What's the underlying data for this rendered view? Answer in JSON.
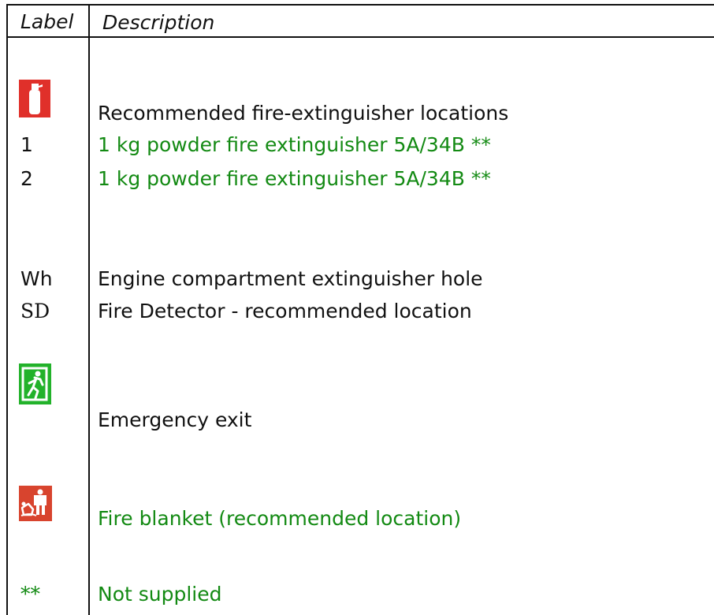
{
  "header": {
    "label": "Label",
    "description": "Description"
  },
  "icons": {
    "extinguisher": "fire-extinguisher-icon",
    "exit": "emergency-exit-icon",
    "blanket": "fire-blanket-icon"
  },
  "rows": {
    "extinguisher_locations": "Recommended fire-extinguisher locations",
    "ext1_label": "1",
    "ext1_desc": "1 kg powder fire extinguisher 5A/34B **",
    "ext2_label": "2",
    "ext2_desc": "1 kg powder fire extinguisher 5A/34B **",
    "wh_label": "Wh",
    "wh_desc": "Engine compartment extinguisher hole",
    "sd_label": "SD",
    "sd_desc": "Fire Detector - recommended location",
    "exit_desc": "Emergency exit",
    "blanket_desc": "Fire blanket (recommended location)",
    "ns_label": "**",
    "ns_desc": "Not supplied"
  },
  "colors": {
    "green_text": "#138a13",
    "red_sign": "#e0302a",
    "green_sign": "#22b22a",
    "blanket_sign": "#d8442e"
  }
}
